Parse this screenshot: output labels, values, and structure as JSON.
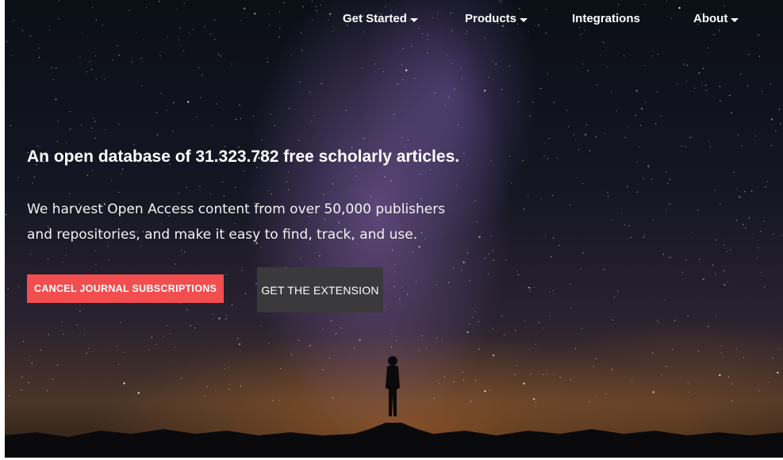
{
  "nav": {
    "items": [
      {
        "label": "Get Started",
        "dropdown": true
      },
      {
        "label": "Products",
        "dropdown": true
      },
      {
        "label": "Integrations",
        "dropdown": false
      },
      {
        "label": "About",
        "dropdown": true
      }
    ]
  },
  "hero": {
    "headline": "An open database of 31.323.782 free scholarly articles.",
    "subtext_line1": "We harvest Open Access content from over 50,000 publishers",
    "subtext_line2": "and repositories, and make it easy to find, track, and use.",
    "primary_button_label": "CANCEL JOURNAL SUBSCRIPTIONS",
    "secondary_button_label": "GET THE EXTENSION"
  },
  "colors": {
    "primary_button": "#f24d4f",
    "secondary_button": "#3a3a3c",
    "text": "#ffffff"
  },
  "icons": {
    "dropdown": "caret-down-icon"
  }
}
